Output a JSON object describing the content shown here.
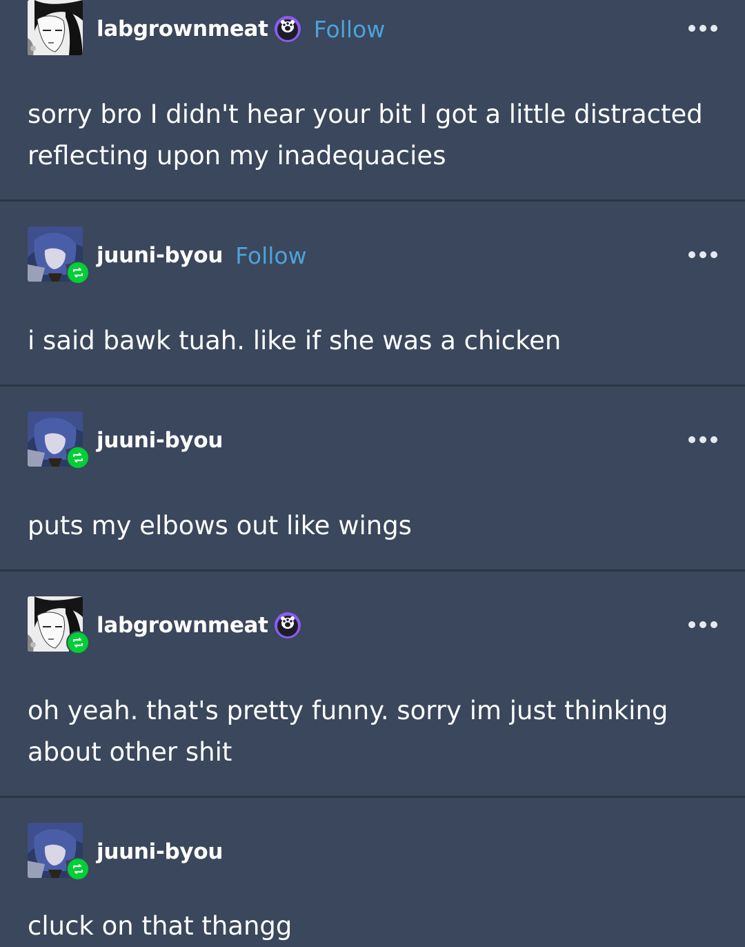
{
  "thread": [
    {
      "username": "labgrownmeat",
      "follow_label": "Follow",
      "has_badge": true,
      "reblogged": false,
      "text": "sorry bro I didn't hear your bit I got a little distracted reflecting upon my inadequacies"
    },
    {
      "username": "juuni-byou",
      "follow_label": "Follow",
      "has_badge": false,
      "reblogged": true,
      "text": "i said bawk tuah. like if she was a chicken"
    },
    {
      "username": "juuni-byou",
      "has_badge": false,
      "reblogged": true,
      "text": "puts my elbows out like wings"
    },
    {
      "username": "labgrownmeat",
      "has_badge": true,
      "reblogged": true,
      "text": "oh yeah. that's pretty funny. sorry im just thinking about other shit"
    },
    {
      "username": "juuni-byou",
      "has_badge": false,
      "reblogged": true,
      "text": "cluck on that thangg"
    }
  ],
  "icons": {
    "more": "more-options-icon",
    "reblog": "reblog-icon",
    "badge": "paw-badge-icon"
  },
  "colors": {
    "background": "#3a475c",
    "divider": "#2b3546",
    "follow": "#4da3d9",
    "reblog_badge": "#00cf35"
  }
}
